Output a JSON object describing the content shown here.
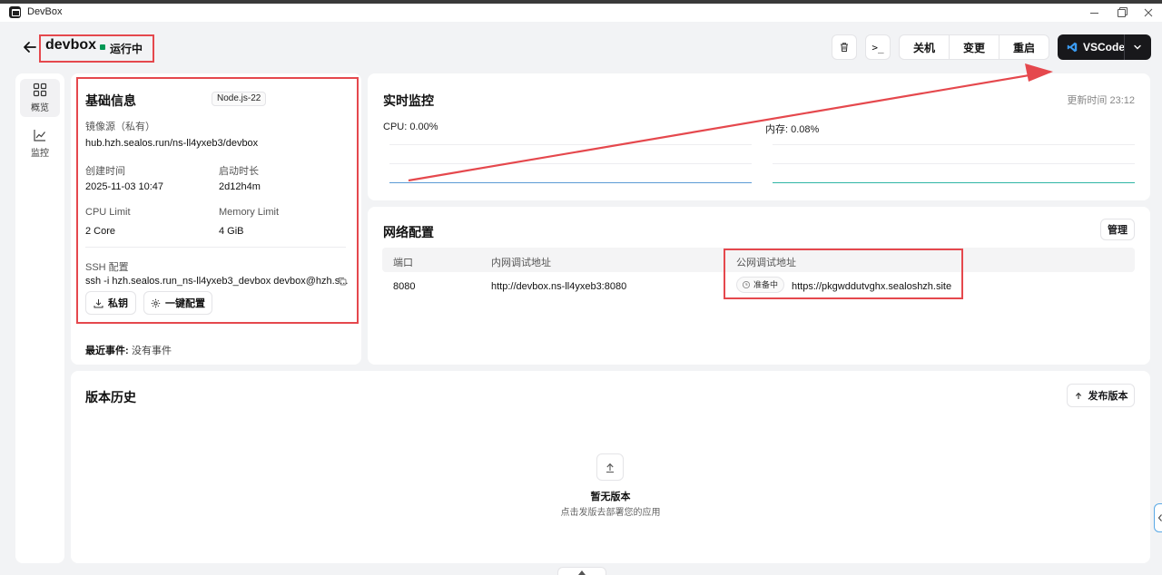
{
  "window": {
    "title": "DevBox"
  },
  "header": {
    "name": "devbox",
    "status": "运行中",
    "actions": [
      "关机",
      "变更",
      "重启"
    ],
    "terminal_label": ">_",
    "vscode_label": "VSCode"
  },
  "sidebar": {
    "items": [
      {
        "label": "概览",
        "icon": "grid-icon",
        "active": true
      },
      {
        "label": "监控",
        "icon": "chart-icon",
        "active": false
      }
    ]
  },
  "basic": {
    "title": "基础信息",
    "runtime_tag": "Node.js-22",
    "image_label": "镜像源（私有）",
    "image_value": "hub.hzh.sealos.run/ns-ll4yxeb3/devbox",
    "created_label": "创建时间",
    "created_value": "2025-11-03 10:47",
    "uptime_label": "启动时长",
    "uptime_value": "2d12h4m",
    "cpu_label": "CPU Limit",
    "cpu_value": "2 Core",
    "memory_label": "Memory Limit",
    "memory_value": "4 GiB",
    "ssh_label": "SSH 配置",
    "ssh_value": "ssh -i hzh.sealos.run_ns-ll4yxeb3_devbox devbox@hzh.s...",
    "private_key_button": "私钥",
    "one_click_button": "一键配置",
    "events_label": "最近事件:",
    "events_value": "没有事件"
  },
  "monitor": {
    "title": "实时监控",
    "updated": "更新时间  23:12",
    "cpu_label": "CPU: 0.00%",
    "memory_label": "内存: 0.08%",
    "cpu_color": "#5b9bd5",
    "memory_color": "#2fb5a5"
  },
  "network": {
    "title": "网络配置",
    "manage_button": "管理",
    "columns": [
      "端口",
      "内网调试地址",
      "公网调试地址"
    ],
    "rows": [
      {
        "port": "8080",
        "internal": "http://devbox.ns-ll4yxeb3:8080",
        "status": "准备中",
        "public": "https://pkgwddutvghx.sealoshzh.site"
      }
    ]
  },
  "versions": {
    "title": "版本历史",
    "publish_button": "发布版本",
    "empty_title": "暂无版本",
    "empty_subtitle": "点击发版去部署您的应用"
  },
  "colors": {
    "highlight": "#e5484d",
    "status_green": "#039855",
    "dark_button": "#18181b"
  }
}
